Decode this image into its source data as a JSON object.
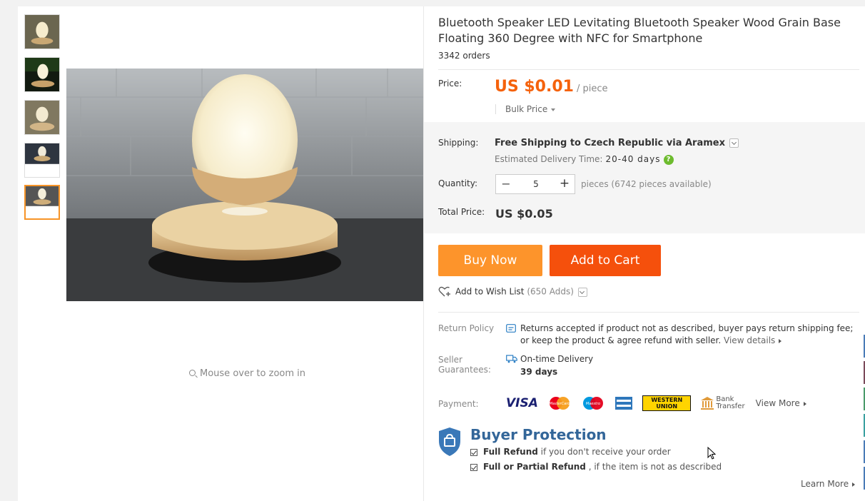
{
  "product": {
    "title": "Bluetooth Speaker LED Levitating Bluetooth Speaker Wood Grain Base Floating 360 Degree with NFC for Smartphone",
    "orders": "3342 orders"
  },
  "gallery": {
    "zoom_hint": "Mouse over to zoom in",
    "thumbnails": 5,
    "selected_thumbnail": 5
  },
  "price": {
    "label": "Price:",
    "value": "US $0.01",
    "unit": "/ piece",
    "bulk_label": "Bulk Price"
  },
  "shipping": {
    "label": "Shipping:",
    "method": "Free Shipping to Czech Republic via Aramex",
    "delivery_label": "Estimated Delivery Time:",
    "delivery_days": "20-40 days"
  },
  "quantity": {
    "label": "Quantity:",
    "minus": "−",
    "value": "5",
    "plus": "+",
    "available": "pieces (6742 pieces available)"
  },
  "total": {
    "label": "Total Price:",
    "value": "US $0.05"
  },
  "actions": {
    "buy_now": "Buy Now",
    "add_to_cart": "Add to Cart",
    "wishlist": "Add to Wish List",
    "wishlist_count": "(650 Adds)"
  },
  "return_policy": {
    "label": "Return Policy",
    "text": "Returns accepted if product not as described, buyer pays return shipping fee; or keep the product & agree refund with seller.",
    "link": "View details"
  },
  "seller_guarantees": {
    "label_1": "Seller",
    "label_2": "Guarantees:",
    "line1": "On-time Delivery",
    "line2": "39 days"
  },
  "payment": {
    "label": "Payment:",
    "visa": "VISA",
    "mastercard": "MasterCard",
    "maestro": "Maestro",
    "wu_1": "WESTERN",
    "wu_2": "UNION",
    "bank_1": "Bank",
    "bank_2": "Transfer",
    "view_more": "View More"
  },
  "buyer_protection": {
    "title": "Buyer Protection",
    "item1_bold": "Full Refund",
    "item1_rest": " if you don't receive your order",
    "item2_bold": "Full or Partial Refund",
    "item2_rest": " , if the item is not as described",
    "learn_more": "Learn More"
  },
  "colors": {
    "price": "#f5620c",
    "buy_now": "#fd942b",
    "add_to_cart": "#f5500c",
    "protection": "#336699"
  }
}
